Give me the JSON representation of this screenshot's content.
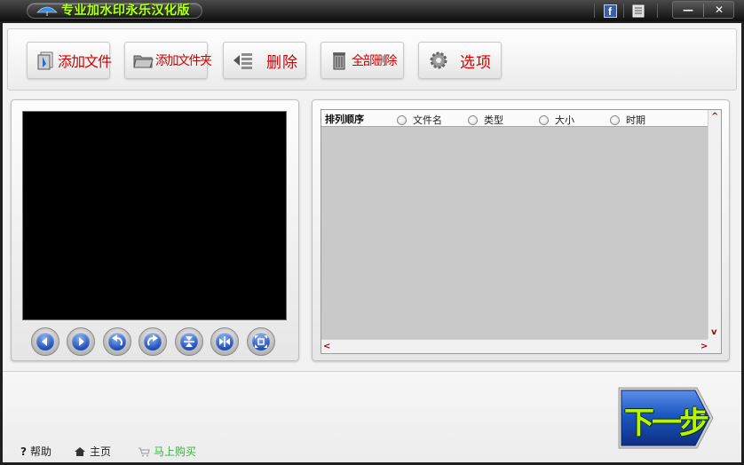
{
  "window": {
    "title": "专业加水印永乐汉化版",
    "facebook_glyph": "f",
    "min_glyph": "—",
    "close_glyph": "✕"
  },
  "toolbar": {
    "add_file": "添加文件",
    "add_folder": "添加文件夹",
    "delete": "删除",
    "delete_all": "全部删除",
    "options": "选项"
  },
  "list": {
    "sort_label": "排列顺序",
    "sort_options": [
      "文件名",
      "类型",
      "大小",
      "时期"
    ],
    "scroll_up": "^",
    "scroll_down": "v",
    "scroll_left": "<",
    "scroll_right": ">"
  },
  "footer": {
    "help": "帮助",
    "home": "主页",
    "buy": "马上购买",
    "help_glyph": "?",
    "next": "下一步"
  },
  "colors": {
    "title_green": "#b8ff20",
    "toolbar_label_red": "#d10000",
    "buy_green": "#2dbf2d",
    "nav_blue": "#1c4cb8",
    "next_blue": "#1a56c4"
  },
  "icons": {
    "nav": [
      "arrow-left-icon",
      "arrow-right-icon",
      "rotate-left-icon",
      "rotate-right-icon",
      "flip-vertical-icon",
      "flip-horizontal-icon",
      "fit-screen-icon"
    ]
  }
}
